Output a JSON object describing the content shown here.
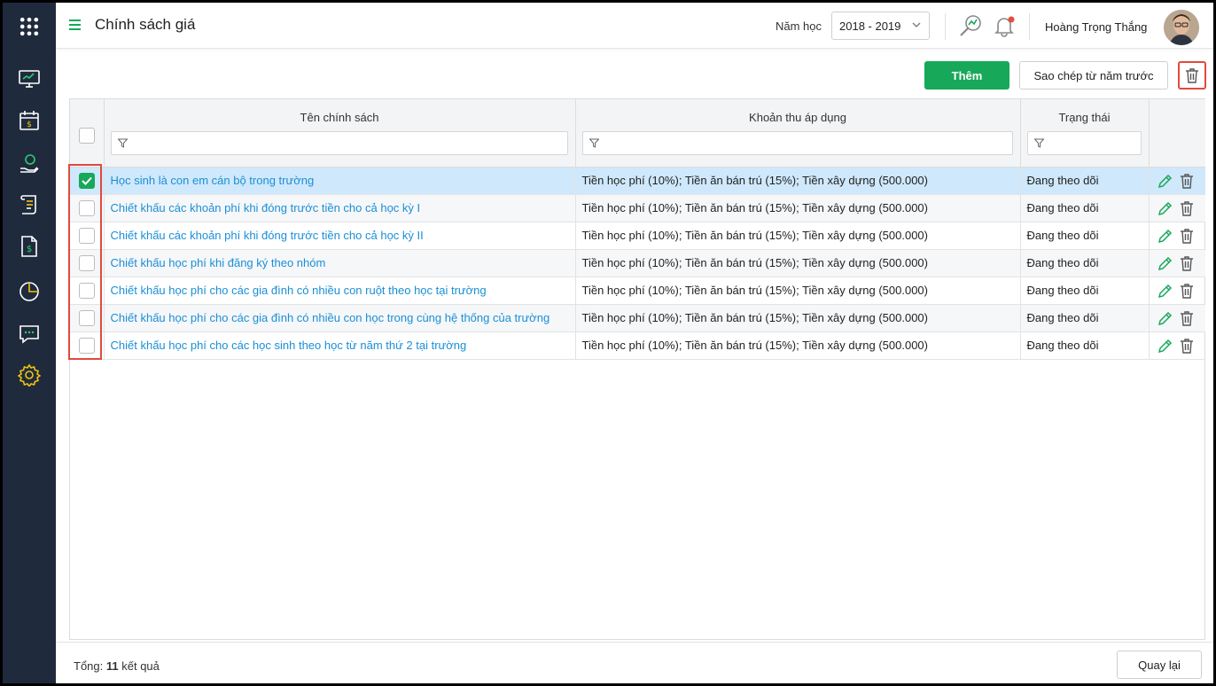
{
  "header": {
    "title": "Chính sách giá",
    "year_label": "Năm học",
    "year_value": "2018 - 2019",
    "user_name": "Hoàng Trọng Thắng"
  },
  "sidebar": {
    "items": [
      {
        "icon": "monitor-icon"
      },
      {
        "icon": "calendar-dollar-icon"
      },
      {
        "icon": "hand-coin-icon"
      },
      {
        "icon": "scroll-icon"
      },
      {
        "icon": "invoice-dollar-icon"
      },
      {
        "icon": "pie-chart-icon"
      },
      {
        "icon": "chat-icon"
      },
      {
        "icon": "gear-icon"
      }
    ]
  },
  "toolbar": {
    "add_label": "Thêm",
    "copy_label": "Sao chép từ năm trước"
  },
  "table": {
    "columns": [
      "Tên chính sách",
      "Khoản thu áp dụng",
      "Trạng thái"
    ],
    "rows": [
      {
        "name": "Học sinh là con em cán bộ trong trường",
        "fees": "Tiền học phí (10%); Tiền ăn bán trú (15%); Tiền xây dựng (500.000)",
        "status": "Đang theo dõi",
        "checked": true
      },
      {
        "name": "Chiết khấu các khoản phí khi đóng trước tiền cho cả học kỳ I",
        "fees": "Tiền học phí (10%); Tiền ăn bán trú (15%); Tiền xây dựng (500.000)",
        "status": "Đang theo dõi",
        "checked": false
      },
      {
        "name": "Chiết khấu các khoản phí khi đóng trước tiền cho cả học kỳ II",
        "fees": "Tiền học phí (10%); Tiền ăn bán trú (15%); Tiền xây dựng (500.000)",
        "status": "Đang theo dõi",
        "checked": false
      },
      {
        "name": "Chiết khấu học phí khi đăng ký theo nhóm",
        "fees": "Tiền học phí (10%); Tiền ăn bán trú (15%); Tiền xây dựng (500.000)",
        "status": "Đang theo dõi",
        "checked": false
      },
      {
        "name": "Chiết khấu học phí cho các gia đình có nhiều con ruột theo học tại trường",
        "fees": "Tiền học phí (10%); Tiền ăn bán trú (15%); Tiền xây dựng (500.000)",
        "status": "Đang theo dõi",
        "checked": false
      },
      {
        "name": "Chiết khấu học phí cho các gia đình có nhiều con học trong cùng hệ thống của trường",
        "fees": "Tiền học phí (10%); Tiền ăn bán trú (15%); Tiền xây dựng (500.000)",
        "status": "Đang theo dõi",
        "checked": false
      },
      {
        "name": "Chiết khấu học phí cho các học sinh theo học từ năm thứ 2 tại trường",
        "fees": "Tiền học phí (10%); Tiền ăn bán trú (15%); Tiền xây dựng (500.000)",
        "status": "Đang theo dõi",
        "checked": false
      }
    ]
  },
  "footer": {
    "total_prefix": "Tổng:",
    "total_count": "11",
    "total_suffix": "kết quả",
    "back_label": "Quay lại"
  },
  "colors": {
    "sidebar_bg": "#1f2b3d",
    "accent_green": "#17a85a",
    "link_blue": "#1a8fd6",
    "selected_row": "#cfe8fb",
    "highlight_red": "#e04a3f"
  }
}
